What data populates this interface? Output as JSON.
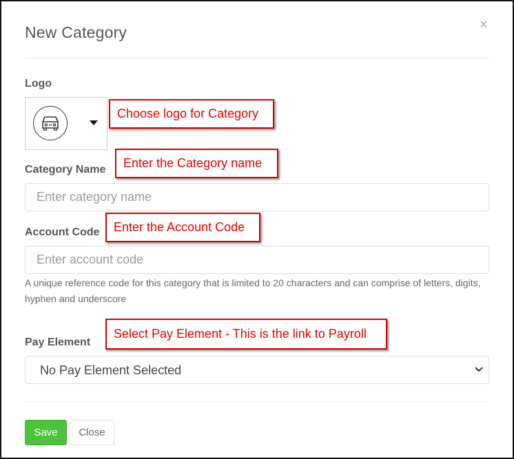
{
  "modal": {
    "title": "New Category",
    "close_symbol": "×"
  },
  "logo": {
    "label": "Logo",
    "icon": "car-icon"
  },
  "category_name": {
    "label": "Category Name",
    "value": "",
    "placeholder": "Enter category name"
  },
  "account_code": {
    "label": "Account Code",
    "value": "",
    "placeholder": "Enter account code",
    "help": "A unique reference code for this category that is limited to 20 characters and can comprise of letters, digits, hyphen and underscore"
  },
  "pay_element": {
    "label": "Pay Element",
    "selected": "No Pay Element Selected"
  },
  "footer": {
    "save_label": "Save",
    "close_label": "Close"
  },
  "annotations": {
    "logo": "Choose logo for Category",
    "category_name": "Enter the Category name",
    "account_code": "Enter the Account Code",
    "pay_element": "Select Pay Element - This is the link to Payroll"
  },
  "colors": {
    "save_button": "#4cc23d",
    "annotation": "#e00000"
  }
}
